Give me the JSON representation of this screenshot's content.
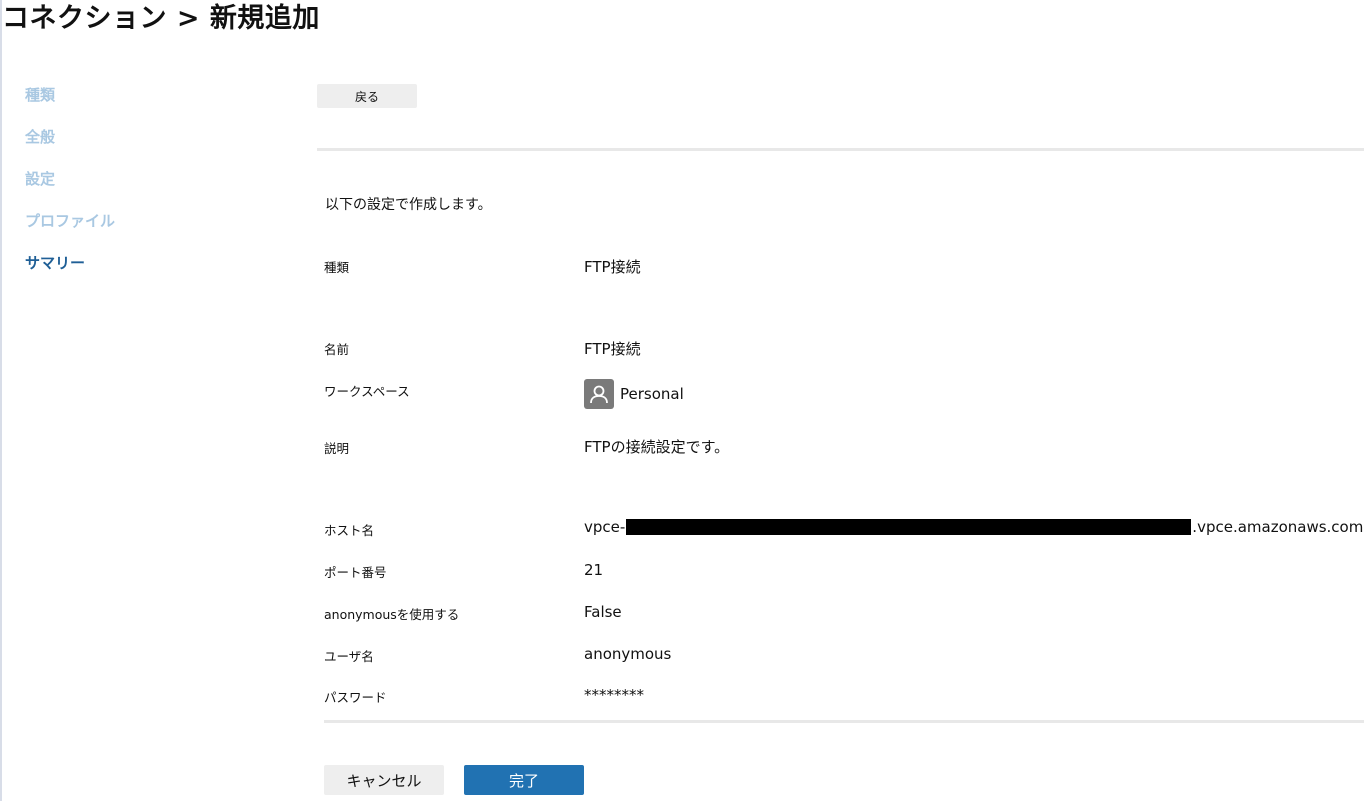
{
  "header": {
    "title": "コネクション > 新規追加"
  },
  "steps": [
    {
      "label": "種類",
      "active": false
    },
    {
      "label": "全般",
      "active": false
    },
    {
      "label": "設定",
      "active": false
    },
    {
      "label": "プロファイル",
      "active": false
    },
    {
      "label": "サマリー",
      "active": true
    }
  ],
  "toolbar": {
    "back_label": "戻る"
  },
  "summary": {
    "intro": "以下の設定で作成します。",
    "type": {
      "label": "種類",
      "value": "FTP接続"
    },
    "name": {
      "label": "名前",
      "value": "FTP接続"
    },
    "workspace": {
      "label": "ワークスペース",
      "value": "Personal",
      "icon": "user-icon"
    },
    "description": {
      "label": "説明",
      "value": "FTPの接続設定です。"
    },
    "host": {
      "label": "ホスト名",
      "prefix": "vpce-",
      "suffix": ".vpce.amazonaws.com",
      "redacted": true
    },
    "port": {
      "label": "ポート番号",
      "value": "21"
    },
    "anonymous": {
      "label": "anonymousを使用する",
      "value": "False"
    },
    "username": {
      "label": "ユーザ名",
      "value": "anonymous"
    },
    "password": {
      "label": "パスワード",
      "value": "********"
    }
  },
  "footer": {
    "cancel_label": "キャンセル",
    "finish_label": "完了"
  },
  "colors": {
    "accent": "#2172b2",
    "step_active": "#1f5f96",
    "step_inactive": "#a9c8e2"
  }
}
